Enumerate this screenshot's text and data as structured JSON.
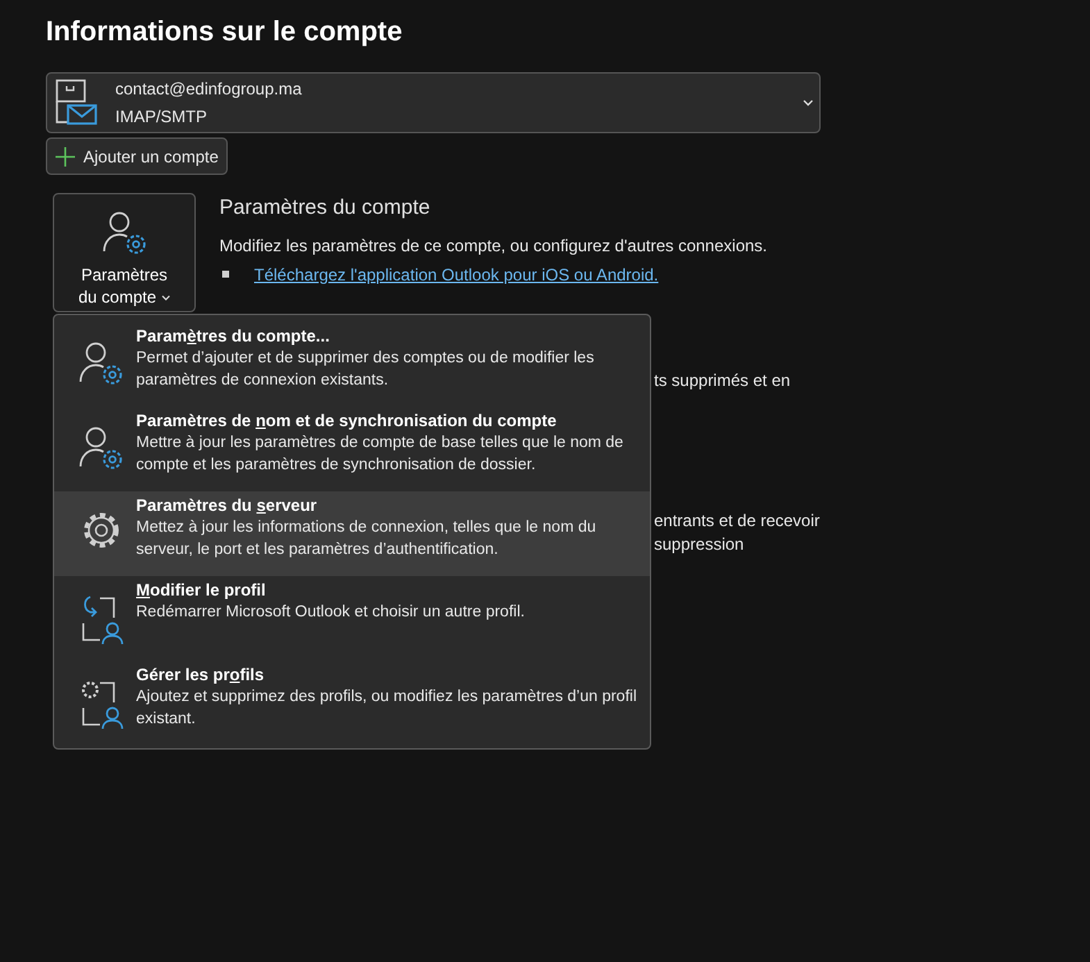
{
  "page_title": "Informations sur le compte",
  "account": {
    "email": "contact@edinfogroup.ma",
    "type": "IMAP/SMTP"
  },
  "add_account_button": "Ajouter un compte",
  "settings_tile": {
    "line_1": "Paramètres",
    "line_2": "du compte"
  },
  "section": {
    "title": "Paramètres du compte",
    "description": "Modifiez les paramètres de ce compte, ou configurez d'autres connexions.",
    "link": "Téléchargez l'application Outlook pour iOS ou Android."
  },
  "hidden_text_fragments": [
    {
      "text": "ts supprimés et en"
    },
    {
      "text": "entrants et de recevoir"
    },
    {
      "text": "suppression"
    }
  ],
  "menu": [
    {
      "kind": "account",
      "title_before": "Param",
      "access_key": "è",
      "title_after": "tres du compte...",
      "description": "Permet d’ajouter et de supprimer des comptes ou de modifier les paramètres de connexion existants.",
      "selected": false
    },
    {
      "kind": "account",
      "title_before": "Paramètres de ",
      "access_key": "n",
      "title_after": "om et de synchronisation du compte",
      "description": "Mettre à jour les paramètres de compte de base telles que le nom de compte et les paramètres de synchronisation de dossier.",
      "selected": false
    },
    {
      "kind": "server",
      "title_before": "Paramètres du ",
      "access_key": "s",
      "title_after": "erveur",
      "description": "Mettez à jour les informations de connexion, telles que le nom du serveur, le port et les paramètres d’authentification.",
      "selected": true
    },
    {
      "kind": "switch",
      "access_key": "M",
      "title_after": "odifier le profil",
      "description": "Redémarrer Microsoft Outlook et choisir un autre profil.",
      "selected": false
    },
    {
      "kind": "manage",
      "title_before": "Gérer les pr",
      "access_key": "o",
      "title_after": "fils",
      "description": "Ajoutez et supprimez des profils, ou modifiez les paramètres d’un profil existant.",
      "selected": false
    }
  ]
}
